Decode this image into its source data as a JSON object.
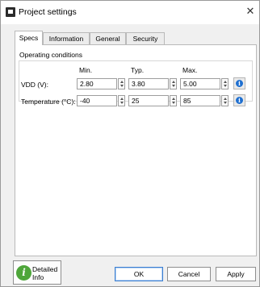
{
  "window": {
    "title": "Project settings",
    "close_glyph": "✕"
  },
  "tabs": [
    {
      "label": "Specs",
      "active": true
    },
    {
      "label": "Information",
      "active": false
    },
    {
      "label": "General",
      "active": false
    },
    {
      "label": "Security",
      "active": false
    }
  ],
  "specs": {
    "section_title": "Operating conditions",
    "columns": {
      "min": "Min.",
      "typ": "Typ.",
      "max": "Max."
    },
    "rows": [
      {
        "label": "VDD (V):",
        "min": "2.80",
        "typ": "3.80",
        "max": "5.00"
      },
      {
        "label": "Temperature (°C):",
        "min": "-40",
        "typ": "25",
        "max": "85"
      }
    ],
    "info_icon": "info-icon"
  },
  "footer": {
    "detailed_info_label": "Detailed Info",
    "ok_label": "OK",
    "cancel_label": "Cancel",
    "apply_label": "Apply"
  },
  "colors": {
    "accent": "#1e6fd0",
    "info_green": "#4ea63a"
  }
}
